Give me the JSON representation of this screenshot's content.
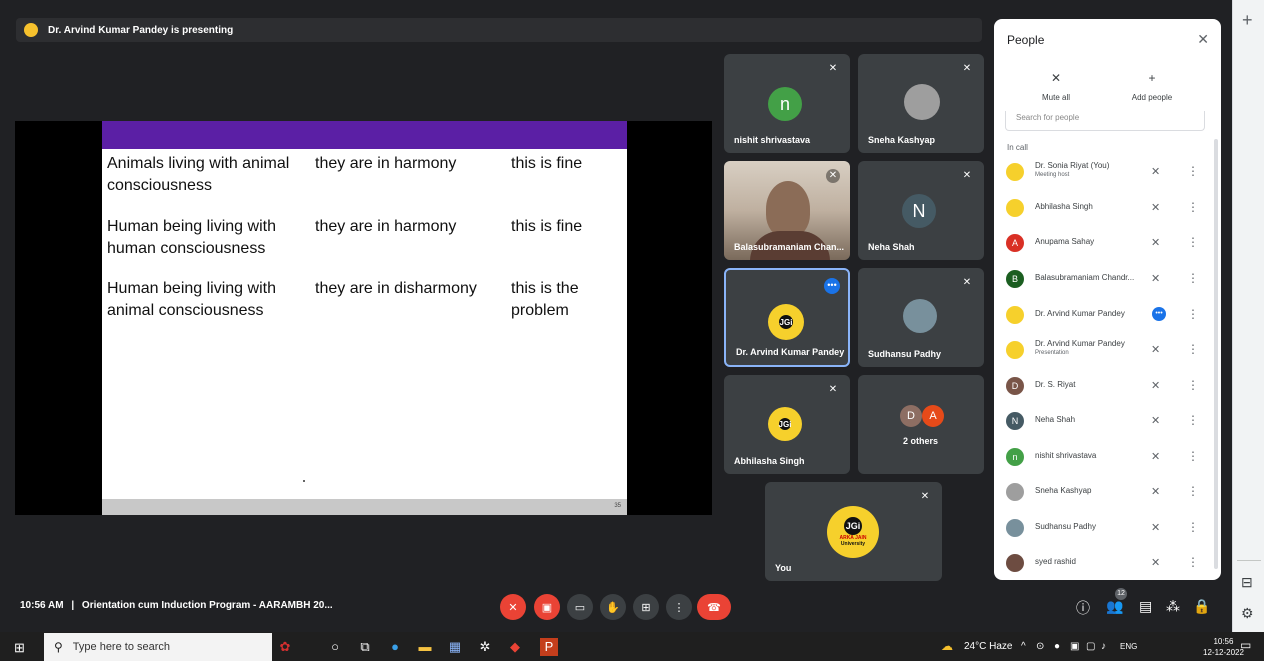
{
  "presenting": "Dr. Arvind Kumar Pandey is presenting",
  "slide": {
    "rows": [
      {
        "c1": "Animals living with animal consciousness",
        "c2": "they are in harmony",
        "c3": "this is fine"
      },
      {
        "c1": "Human being living with human consciousness",
        "c2": "they are in harmony",
        "c3": "this is fine"
      },
      {
        "c1": "Human being living with animal consciousness",
        "c2": "they are in disharmony",
        "c3": "this is the problem"
      }
    ],
    "page_number": "35"
  },
  "tiles": {
    "nishit": {
      "name": "nishit shrivastava",
      "initial": "n"
    },
    "sneha": {
      "name": "Sneha Kashyap"
    },
    "bala": {
      "name": "Balasubramaniam Chan..."
    },
    "neha": {
      "name": "Neha Shah",
      "initial": "N"
    },
    "arvind": {
      "name": "Dr. Arvind Kumar Pandey"
    },
    "sudhansu": {
      "name": "Sudhansu Padhy"
    },
    "abhilasha": {
      "name": "Abhilasha Singh"
    },
    "others": {
      "label": "2 others",
      "a1": "D",
      "a2": "A"
    },
    "you": {
      "name": "You"
    },
    "logo": {
      "jgi": "JGi",
      "line1": "ARKA JAIN",
      "line2": "University"
    }
  },
  "people": {
    "title": "People",
    "mute_all": "Mute all",
    "add_people": "Add people",
    "search_placeholder": "Search for people",
    "in_call": "In call",
    "list": [
      {
        "name": "Dr. Sonia Riyat (You)",
        "sub": "Meeting host",
        "initial": ""
      },
      {
        "name": "Abhilasha Singh",
        "sub": "",
        "initial": ""
      },
      {
        "name": "Anupama Sahay",
        "sub": "",
        "initial": "A"
      },
      {
        "name": "Balasubramaniam Chandr...",
        "sub": "",
        "initial": "B"
      },
      {
        "name": "Dr. Arvind Kumar Pandey",
        "sub": "",
        "initial": ""
      },
      {
        "name": "Dr. Arvind Kumar Pandey",
        "sub": "Presentation",
        "initial": ""
      },
      {
        "name": "Dr. S. Riyat",
        "sub": "",
        "initial": "D"
      },
      {
        "name": "Neha Shah",
        "sub": "",
        "initial": "N"
      },
      {
        "name": "nishit shrivastava",
        "sub": "",
        "initial": "n"
      },
      {
        "name": "Sneha Kashyap",
        "sub": "",
        "initial": ""
      },
      {
        "name": "Sudhansu Padhy",
        "sub": "",
        "initial": ""
      },
      {
        "name": "syed rashid",
        "sub": "",
        "initial": ""
      }
    ]
  },
  "bottom": {
    "time": "10:56 AM",
    "separator": "|",
    "meeting_title": "Orientation cum Induction Program - AARAMBH 20...",
    "participant_count": "12"
  },
  "taskbar": {
    "search_placeholder": "Type here to search",
    "weather": "24°C Haze",
    "language": "ENG",
    "time": "10:56",
    "date": "12-12-2022"
  },
  "colors": {
    "accent": "#1a73e8",
    "danger": "#ea4335",
    "slide_header": "#5b1fa5",
    "logo_yellow": "#f6d02c"
  }
}
